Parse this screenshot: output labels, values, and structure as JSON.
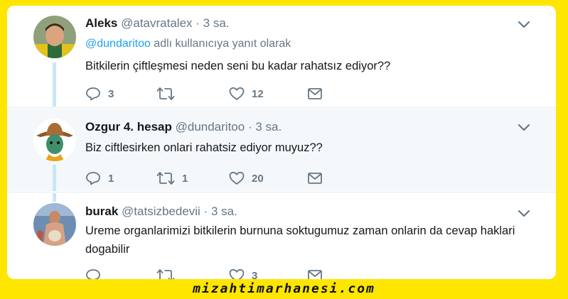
{
  "tweets": [
    {
      "name": "Aleks",
      "handle": "@atavratalex",
      "time": "3 sa.",
      "reply_mention": "@dundaritoo",
      "reply_suffix": " adlı kullanıcıya yanıt olarak",
      "text": "Bitkilerin çiftleşmesi neden seni bu kadar rahatsız ediyor??",
      "replies": "3",
      "retweets": "",
      "likes": "12"
    },
    {
      "name": "Ozgur 4. hesap",
      "handle": "@dundaritoo",
      "time": "3 sa.",
      "text": "Biz ciftlesirken onlari rahatsiz ediyor muyuz??",
      "replies": "1",
      "retweets": "1",
      "likes": "20"
    },
    {
      "name": "burak",
      "handle": "@tatsizbedevii",
      "time": "3 sa.",
      "text": "Ureme organlarimizi bitkilerin burnuna soktugumuz zaman onlarin da cevap haklari dogabilir",
      "replies": "",
      "retweets": "",
      "likes": "3"
    }
  ],
  "separator": "·",
  "icons": [
    "reply-icon",
    "retweet-icon",
    "like-icon",
    "dm-icon",
    "chevron-down-icon"
  ],
  "colors": {
    "background": "#ffe600",
    "link": "#1da1f2",
    "muted": "#657786",
    "thread_line": "#c7e6fa",
    "highlight_row": "#f5f8fa"
  },
  "watermark": "mizahtimarhanesi.com"
}
